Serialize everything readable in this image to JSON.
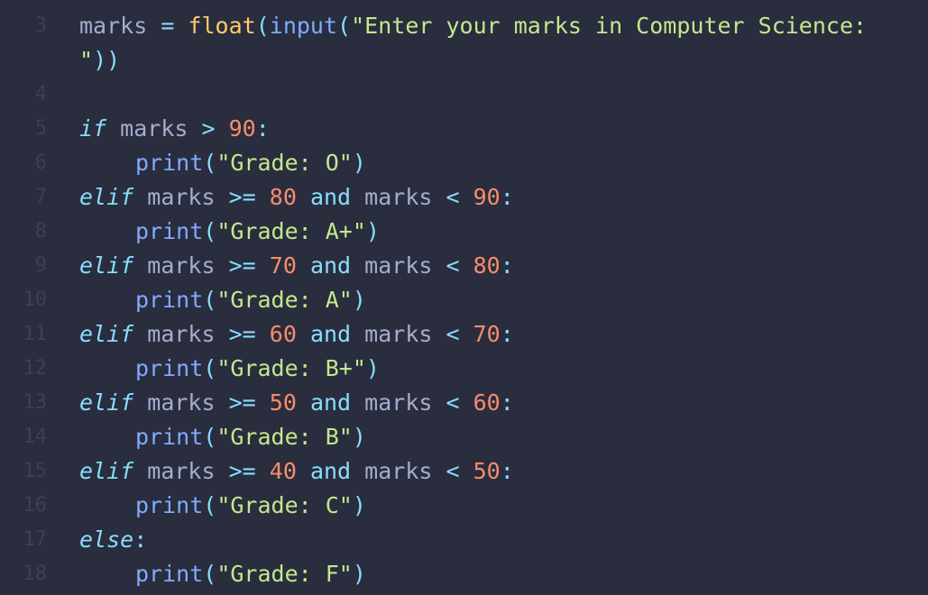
{
  "theme": {
    "background": "#292d3e",
    "line_number_color": "#3c4057",
    "default_text": "#a6accd",
    "keyword": "#89ddff",
    "function": "#ffcb6b",
    "builtin": "#82aaff",
    "string": "#c3e88d",
    "number": "#f78c6c"
  },
  "line_numbers": [
    "3",
    "",
    "4",
    "5",
    "6",
    "7",
    "8",
    "9",
    "10",
    "11",
    "12",
    "13",
    "14",
    "15",
    "16",
    "17",
    "18"
  ],
  "code": {
    "l3": {
      "var": "marks",
      "eq": "=",
      "float": "float",
      "p1": "(",
      "input": "input",
      "p2": "(",
      "str": "\"Enter your marks in Computer Science:"
    },
    "l3b": {
      "str": "\"",
      "close": "))"
    },
    "l5": {
      "kw": "if",
      "var": "marks",
      "op": ">",
      "num": "90",
      "colon": ":"
    },
    "l6": {
      "fn": "print",
      "open": "(",
      "str": "\"Grade: O\"",
      "close": ")"
    },
    "l7": {
      "kw": "elif",
      "var1": "marks",
      "op1": ">=",
      "num1": "80",
      "and": "and",
      "var2": "marks",
      "op2": "<",
      "num2": "90",
      "colon": ":"
    },
    "l8": {
      "fn": "print",
      "open": "(",
      "str": "\"Grade: A+\"",
      "close": ")"
    },
    "l9": {
      "kw": "elif",
      "var1": "marks",
      "op1": ">=",
      "num1": "70",
      "and": "and",
      "var2": "marks",
      "op2": "<",
      "num2": "80",
      "colon": ":"
    },
    "l10": {
      "fn": "print",
      "open": "(",
      "str": "\"Grade: A\"",
      "close": ")"
    },
    "l11": {
      "kw": "elif",
      "var1": "marks",
      "op1": ">=",
      "num1": "60",
      "and": "and",
      "var2": "marks",
      "op2": "<",
      "num2": "70",
      "colon": ":"
    },
    "l12": {
      "fn": "print",
      "open": "(",
      "str": "\"Grade: B+\"",
      "close": ")"
    },
    "l13": {
      "kw": "elif",
      "var1": "marks",
      "op1": ">=",
      "num1": "50",
      "and": "and",
      "var2": "marks",
      "op2": "<",
      "num2": "60",
      "colon": ":"
    },
    "l14": {
      "fn": "print",
      "open": "(",
      "str": "\"Grade: B\"",
      "close": ")"
    },
    "l15": {
      "kw": "elif",
      "var1": "marks",
      "op1": ">=",
      "num1": "40",
      "and": "and",
      "var2": "marks",
      "op2": "<",
      "num2": "50",
      "colon": ":"
    },
    "l16": {
      "fn": "print",
      "open": "(",
      "str": "\"Grade: C\"",
      "close": ")"
    },
    "l17": {
      "kw": "else",
      "colon": ":"
    },
    "l18": {
      "fn": "print",
      "open": "(",
      "str": "\"Grade: F\"",
      "close": ")"
    }
  }
}
